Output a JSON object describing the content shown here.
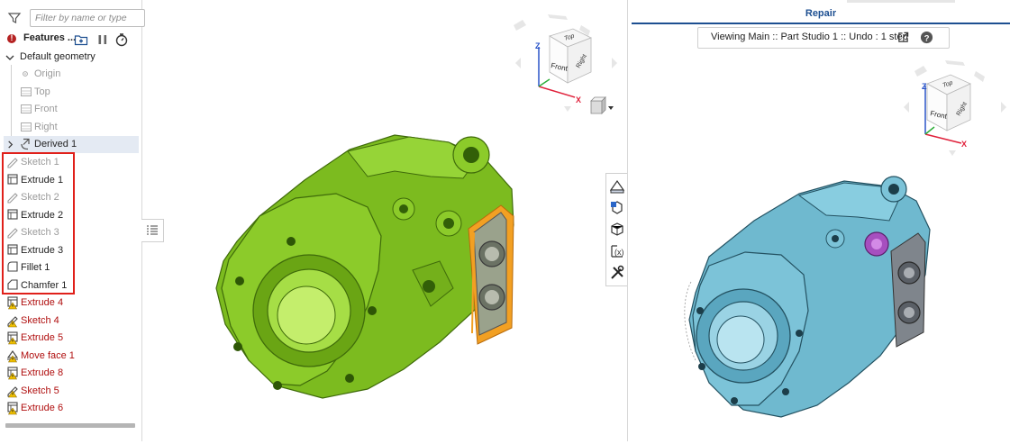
{
  "feature_panel": {
    "filter_placeholder": "Filter by name or type",
    "title": "Features ...",
    "default_geometry": "Default geometry",
    "geometry_items": [
      "Origin",
      "Top",
      "Front",
      "Right"
    ],
    "derived": "Derived 1",
    "features": [
      {
        "label": "Sketch 1",
        "type": "sketch",
        "state": "normal-gray"
      },
      {
        "label": "Extrude 1",
        "type": "extrude",
        "state": "normal"
      },
      {
        "label": "Sketch 2",
        "type": "sketch",
        "state": "normal-gray"
      },
      {
        "label": "Extrude 2",
        "type": "extrude",
        "state": "normal"
      },
      {
        "label": "Sketch 3",
        "type": "sketch",
        "state": "normal-gray"
      },
      {
        "label": "Extrude 3",
        "type": "extrude",
        "state": "normal"
      },
      {
        "label": "Fillet 1",
        "type": "fillet",
        "state": "normal"
      },
      {
        "label": "Chamfer 1",
        "type": "chamfer",
        "state": "normal"
      },
      {
        "label": "Extrude 4",
        "type": "extrude",
        "state": "error"
      },
      {
        "label": "Sketch 4",
        "type": "sketch",
        "state": "error"
      },
      {
        "label": "Extrude 5",
        "type": "extrude",
        "state": "error"
      },
      {
        "label": "Move face 1",
        "type": "moveface",
        "state": "error"
      },
      {
        "label": "Extrude 8",
        "type": "extrude",
        "state": "error"
      },
      {
        "label": "Sketch 5",
        "type": "sketch",
        "state": "error"
      },
      {
        "label": "Extrude 6",
        "type": "extrude",
        "state": "error"
      }
    ]
  },
  "viewcube_left": {
    "top": "Top",
    "front": "Front",
    "right": "Right",
    "axis_x": "X",
    "axis_y": "Y",
    "axis_z": "Z"
  },
  "viewcube_right": {
    "top": "Top",
    "front": "Front",
    "right": "Right",
    "axis_x": "X",
    "axis_y": "Y",
    "axis_z": "Z"
  },
  "repair": {
    "tab_label": "Repair",
    "viewing_text": "Viewing Main :: Part Studio 1 :: Undo : 1 step"
  },
  "colors": {
    "model_left": "#7cbb1f",
    "model_right": "#6fb9cf",
    "error_red": "#b00f0f",
    "selection_orange": "#f2a023",
    "accent_blue": "#1d4f91"
  }
}
